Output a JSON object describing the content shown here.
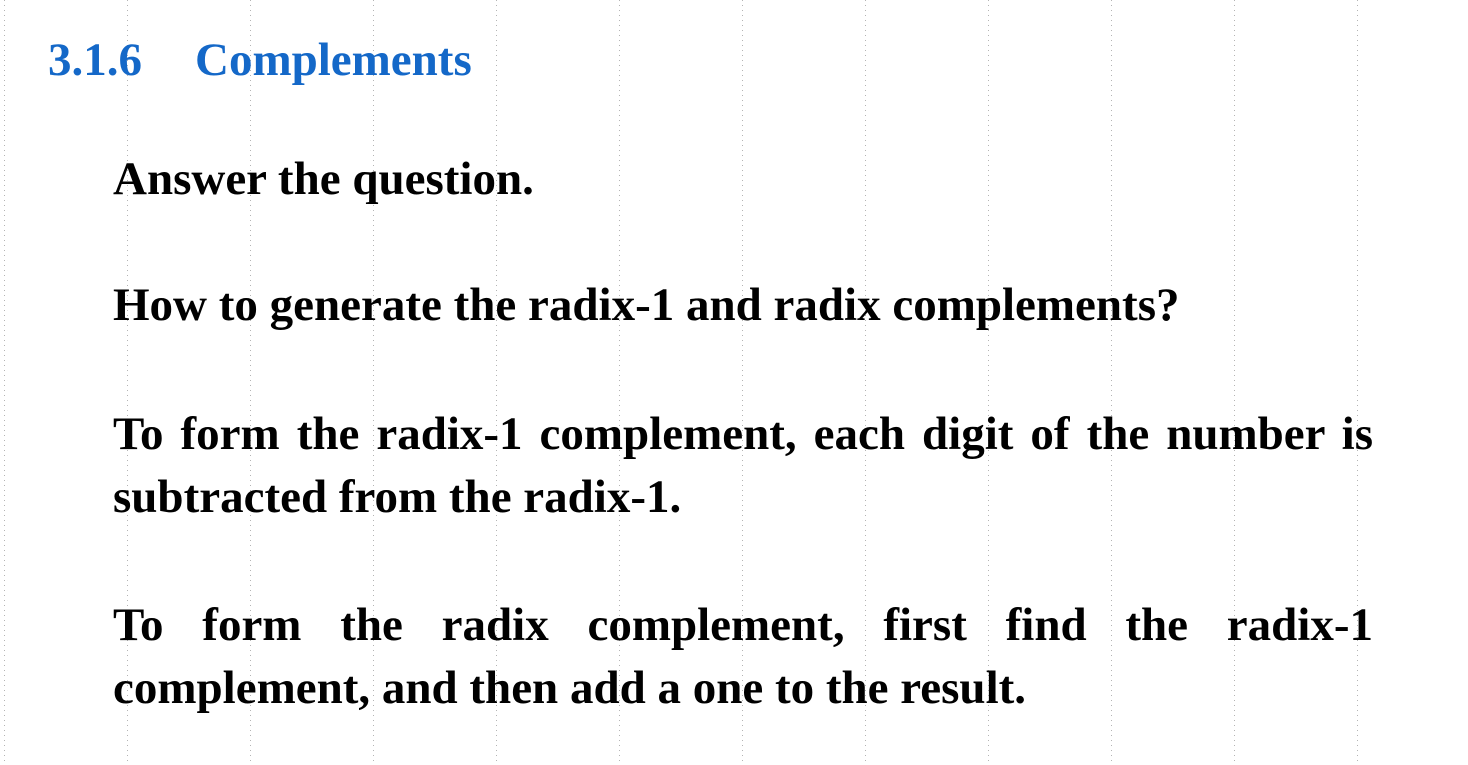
{
  "section": {
    "number": "3.1.6",
    "title": "Complements",
    "color": "#1468c8"
  },
  "paragraphs": {
    "prompt": "Answer the question.",
    "question": "How to generate the radix-1 and radix complements?",
    "answer_radix_minus_1": "To form the radix-1 complement, each digit of the number is subtracted from the radix-1.",
    "answer_radix": "To form the radix complement, first find the radix-1 complement, and then add a one to the result."
  },
  "background": {
    "pattern": "dotted-grid",
    "dot_color": "#b4b4b4"
  }
}
